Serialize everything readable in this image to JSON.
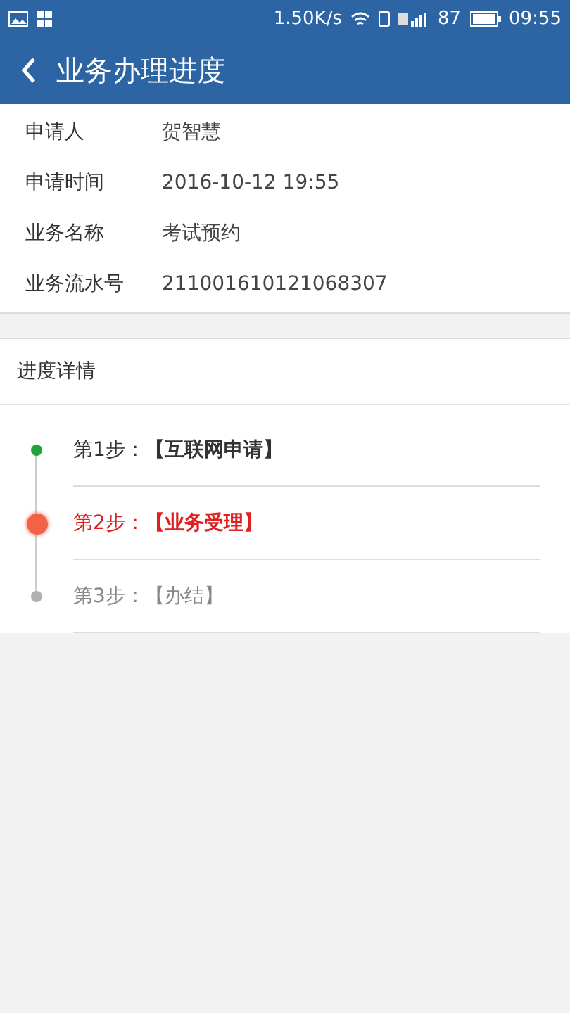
{
  "status_bar": {
    "speed": "1.50K/s",
    "battery": "87",
    "time": "09:55"
  },
  "header": {
    "title": "业务办理进度"
  },
  "info": [
    {
      "label": "申请人",
      "value": "贺智慧"
    },
    {
      "label": "申请时间",
      "value": "2016-10-12 19:55"
    },
    {
      "label": "业务名称",
      "value": "考试预约"
    },
    {
      "label": "业务流水号",
      "value": "211001610121068307"
    }
  ],
  "progress": {
    "title": "进度详情",
    "steps": [
      {
        "text": "第1步：**【互联网申请】**",
        "kind": "done"
      },
      {
        "text": "第2步：**【业务受理】**",
        "kind": "current"
      },
      {
        "text": "第3步：【办结】",
        "kind": "pending"
      }
    ]
  }
}
